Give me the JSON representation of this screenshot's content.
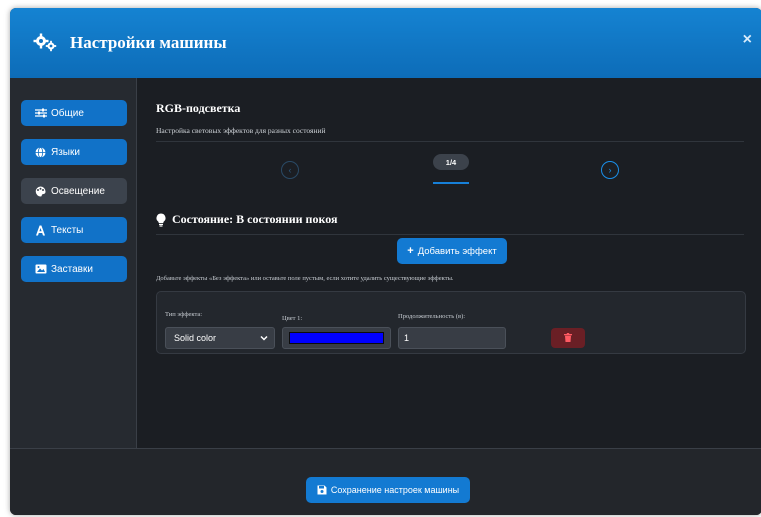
{
  "header": {
    "title": "Настройки машины",
    "icon": "gears-icon",
    "close_label": "×"
  },
  "sidebar": {
    "items": [
      {
        "label": "Общие",
        "icon": "sliders-icon",
        "active": false
      },
      {
        "label": "Языки",
        "icon": "globe-icon",
        "active": false
      },
      {
        "label": "Освещение",
        "icon": "palette-icon",
        "active": true
      },
      {
        "label": "Тексты",
        "icon": "font-icon",
        "active": false
      },
      {
        "label": "Заставки",
        "icon": "image-icon",
        "active": false
      }
    ]
  },
  "content": {
    "title": "RGB-подсветка",
    "subtitle": "Настройка световых эффектов для разных состояний",
    "pager": {
      "prev": "‹",
      "next": "›",
      "indicator": "1/4"
    },
    "state_title": "Состояние: В состоянии покоя",
    "add_effect_label": "Добавить эффект",
    "add_effect_plus": "+",
    "hint": "Добавьте эффекты «Без эффекта» или оставьте поле пустым, если хотите удалить существующие эффекты.",
    "effect": {
      "type_label": "Тип эффекта:",
      "type_value": "Solid color",
      "color_label": "Цвет 1:",
      "color_value": "#0000ff",
      "duration_label": "Продолжительность (в):",
      "duration_value": "1"
    }
  },
  "footer": {
    "save_label": "Сохранение настроек машины"
  },
  "colors": {
    "accent": "#137ad2",
    "header": "#1583d2",
    "background": "#1b1e23",
    "delete": "#6a1f25"
  }
}
